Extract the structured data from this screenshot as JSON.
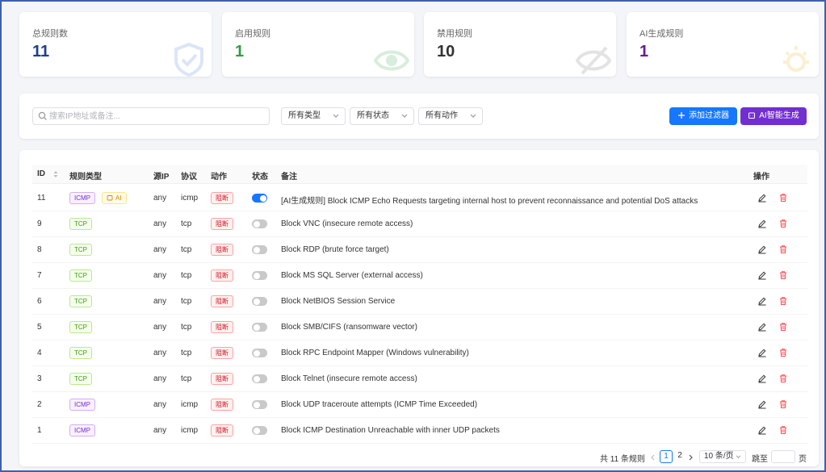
{
  "stats": [
    {
      "label": "总规则数",
      "value": "11",
      "color": "#1d3f8f"
    },
    {
      "label": "启用规则",
      "value": "1",
      "color": "#2f9e44"
    },
    {
      "label": "禁用规则",
      "value": "10",
      "color": "#333333"
    },
    {
      "label": "AI生成规则",
      "value": "1",
      "color": "#6b1b8c"
    }
  ],
  "filters": {
    "search_placeholder": "搜索IP地址或备注...",
    "type": "所有类型",
    "status": "所有状态",
    "action": "所有动作",
    "add_label": "添加过滤器",
    "ai_label": "AI智能生成"
  },
  "table": {
    "headers": {
      "id": "ID",
      "type": "规则类型",
      "src": "源IP",
      "proto": "协议",
      "action": "动作",
      "status": "状态",
      "note": "备注",
      "ops": "操作"
    },
    "rows": [
      {
        "id": "11",
        "type": "ICMP",
        "ai": "AI",
        "src": "any",
        "proto": "icmp",
        "action": "阻断",
        "enabled": true,
        "note": "[AI生成规则] Block ICMP Echo Requests targeting internal host to prevent reconnaissance and potential DoS attacks"
      },
      {
        "id": "9",
        "type": "TCP",
        "src": "any",
        "proto": "tcp",
        "action": "阻断",
        "enabled": false,
        "note": "Block VNC (insecure remote access)"
      },
      {
        "id": "8",
        "type": "TCP",
        "src": "any",
        "proto": "tcp",
        "action": "阻断",
        "enabled": false,
        "note": "Block RDP (brute force target)"
      },
      {
        "id": "7",
        "type": "TCP",
        "src": "any",
        "proto": "tcp",
        "action": "阻断",
        "enabled": false,
        "note": "Block MS SQL Server (external access)"
      },
      {
        "id": "6",
        "type": "TCP",
        "src": "any",
        "proto": "tcp",
        "action": "阻断",
        "enabled": false,
        "note": "Block NetBIOS Session Service"
      },
      {
        "id": "5",
        "type": "TCP",
        "src": "any",
        "proto": "tcp",
        "action": "阻断",
        "enabled": false,
        "note": "Block SMB/CIFS (ransomware vector)"
      },
      {
        "id": "4",
        "type": "TCP",
        "src": "any",
        "proto": "tcp",
        "action": "阻断",
        "enabled": false,
        "note": "Block RPC Endpoint Mapper (Windows vulnerability)"
      },
      {
        "id": "3",
        "type": "TCP",
        "src": "any",
        "proto": "tcp",
        "action": "阻断",
        "enabled": false,
        "note": "Block Telnet (insecure remote access)"
      },
      {
        "id": "2",
        "type": "ICMP",
        "src": "any",
        "proto": "icmp",
        "action": "阻断",
        "enabled": false,
        "note": "Block UDP traceroute attempts (ICMP Time Exceeded)"
      },
      {
        "id": "1",
        "type": "ICMP",
        "src": "any",
        "proto": "icmp",
        "action": "阻断",
        "enabled": false,
        "note": "Block ICMP Destination Unreachable with inner UDP packets"
      }
    ]
  },
  "pagination": {
    "total": "共 11 条规则",
    "page1": "1",
    "page2": "2",
    "page_size": "10 条/页",
    "jump_label": "跳至",
    "page_suffix": "页"
  }
}
